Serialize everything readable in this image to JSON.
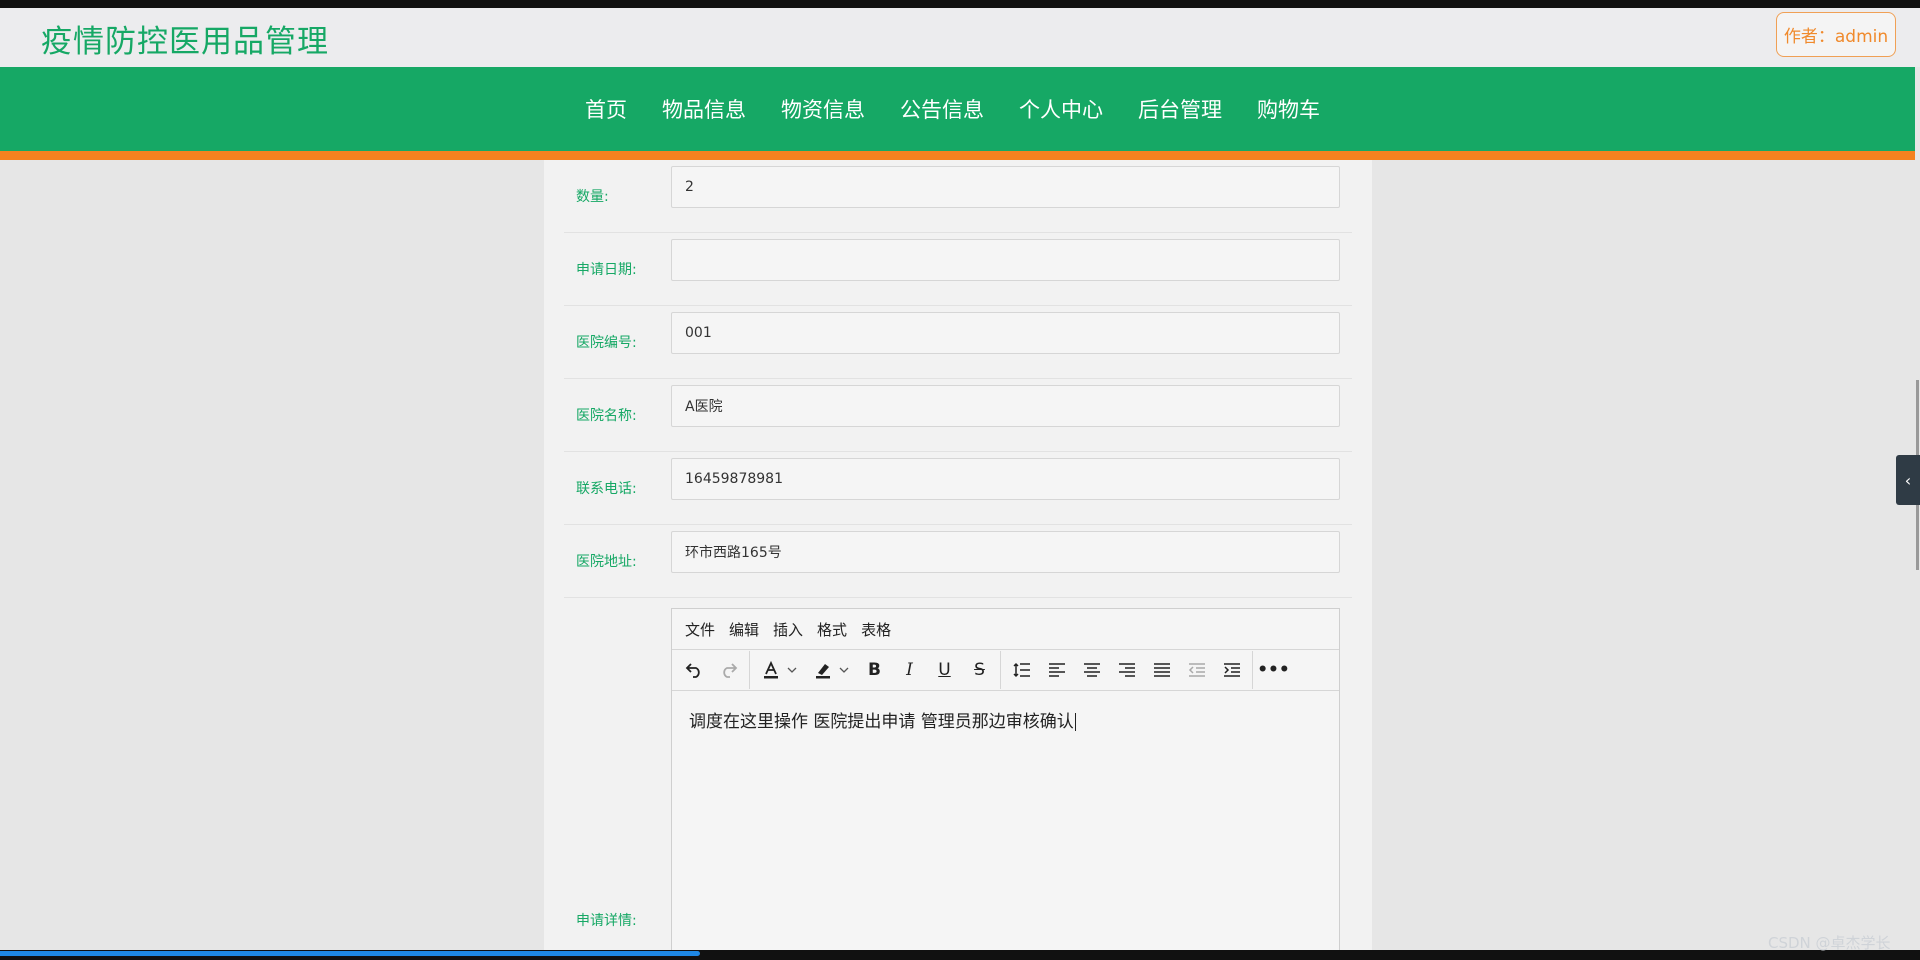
{
  "header": {
    "title": "疫情防控医用品管理",
    "author_button": "作者：admin"
  },
  "nav": {
    "items": [
      "首页",
      "物品信息",
      "物资信息",
      "公告信息",
      "个人中心",
      "后台管理",
      "购物车"
    ]
  },
  "form": {
    "fields": [
      {
        "label": "数量:",
        "value": "2"
      },
      {
        "label": "申请日期:",
        "value": ""
      },
      {
        "label": "医院编号:",
        "value": "001"
      },
      {
        "label": "医院名称:",
        "value": "A医院"
      },
      {
        "label": "联系电话:",
        "value": "16459878981"
      },
      {
        "label": "医院地址:",
        "value": "环市西路165号"
      }
    ],
    "detail_label": "申请详情:"
  },
  "editor": {
    "menu": [
      "文件",
      "编辑",
      "插入",
      "格式",
      "表格"
    ],
    "toolbar_icons": [
      "undo-icon",
      "redo-icon",
      "text-color-icon",
      "highlight-color-icon",
      "bold-icon",
      "italic-icon",
      "underline-icon",
      "strikethrough-icon",
      "line-height-icon",
      "align-left-icon",
      "align-center-icon",
      "align-right-icon",
      "align-justify-icon",
      "outdent-icon",
      "indent-icon",
      "more-icon"
    ],
    "content": "调度在这里操作  医院提出申请  管理员那边审核确认"
  },
  "side_tab_icon": "chevron-left-icon",
  "watermark": "CSDN @卓杰学长",
  "colors": {
    "primary": "#16a865",
    "accent": "#f5821f",
    "author": "#f08a2c"
  }
}
